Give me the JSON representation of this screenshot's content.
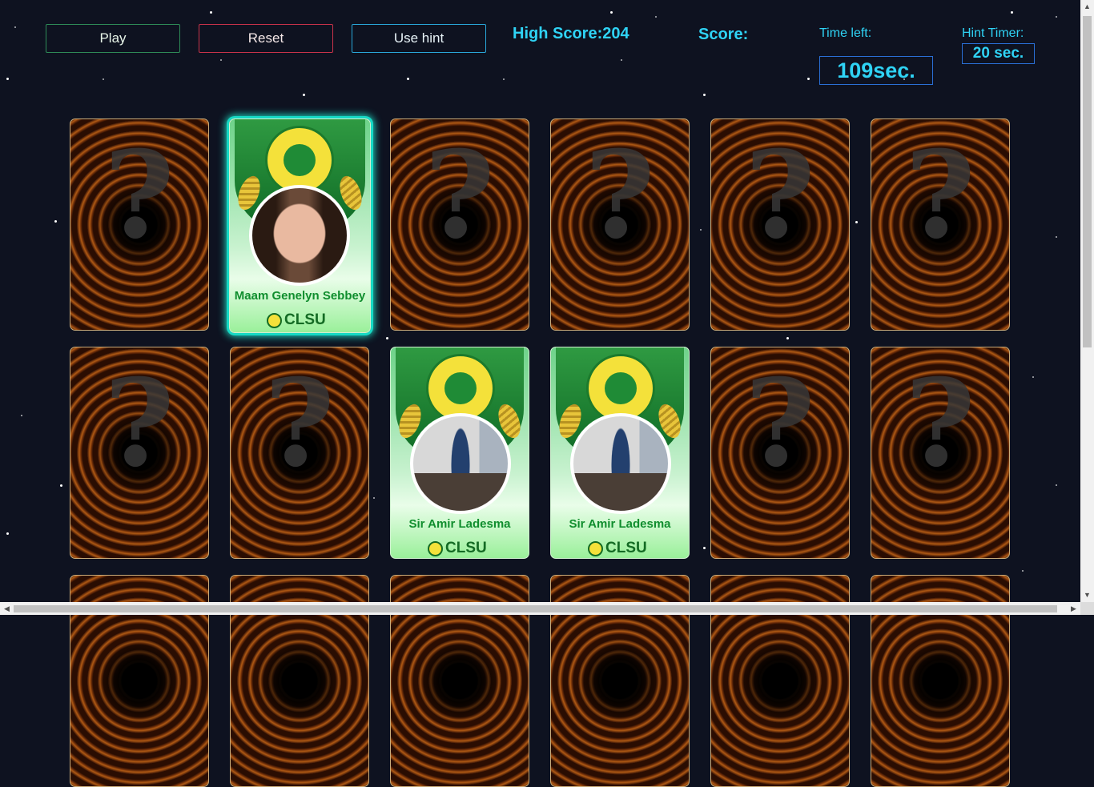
{
  "controls": {
    "play_label": "Play",
    "reset_label": "Reset",
    "hint_label": "Use hint"
  },
  "hud": {
    "high_score": "High Score:204",
    "score_label": "Score:",
    "time_left_label": "Time left:",
    "time_left_value": "109sec.",
    "hint_timer_label": "Hint Timer:",
    "hint_timer_value": "20 sec."
  },
  "cards": {
    "back_glyph": "?",
    "logo_text": "CLSU",
    "row1": [
      {
        "state": "hidden"
      },
      {
        "state": "revealed",
        "name": "Maam Genelyn Sebbey"
      },
      {
        "state": "hidden"
      },
      {
        "state": "hidden"
      },
      {
        "state": "hidden"
      },
      {
        "state": "hidden"
      }
    ],
    "row2": [
      {
        "state": "hidden"
      },
      {
        "state": "hidden"
      },
      {
        "state": "revealed",
        "name": "Sir Amir Ladesma"
      },
      {
        "state": "revealed",
        "name": "Sir Amir Ladesma"
      },
      {
        "state": "hidden"
      },
      {
        "state": "hidden"
      }
    ]
  },
  "colors": {
    "background": "#0e1220",
    "hud_text": "#2fd3f5",
    "play_border": "#2e8b57",
    "reset_border": "#c8324a",
    "hint_border": "#29a7d9",
    "card_name": "#108e2e",
    "selected_glow": "#17d9c4"
  }
}
